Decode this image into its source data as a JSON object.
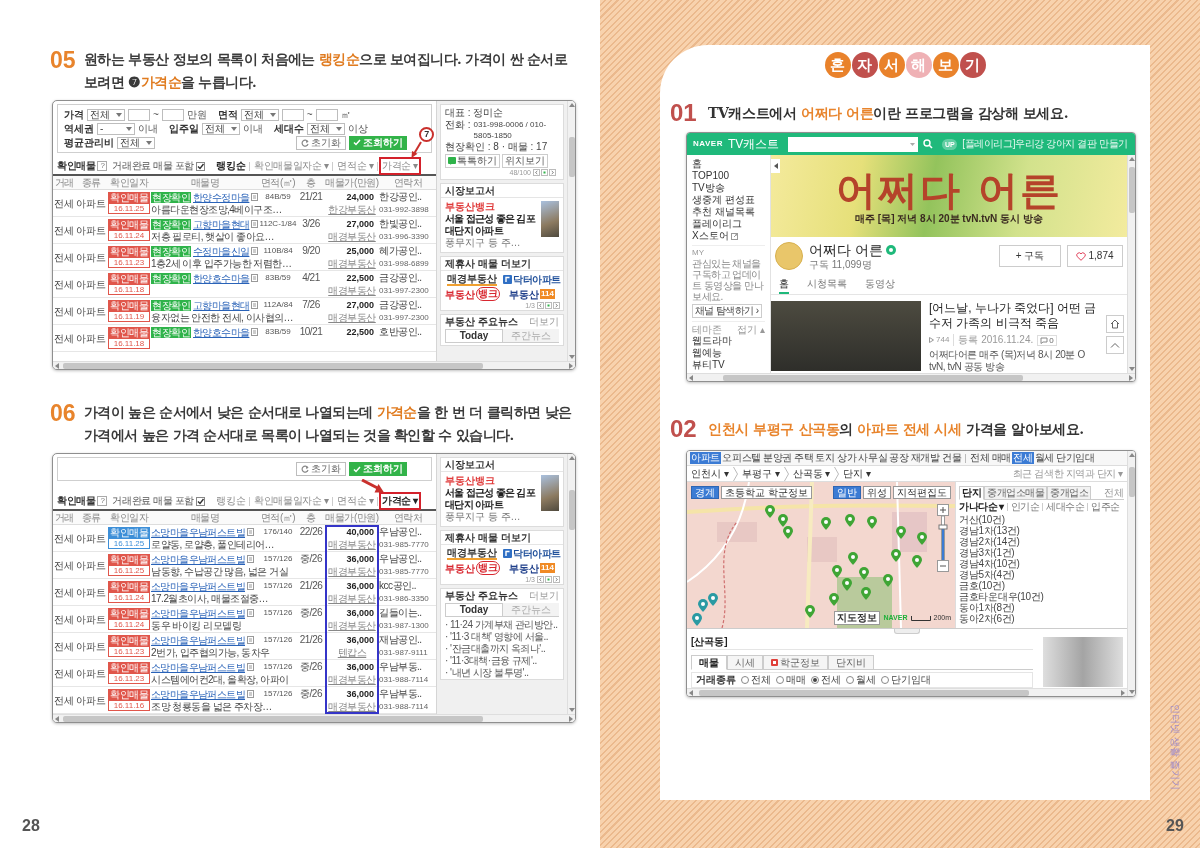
{
  "left_page": {
    "steps": [
      {
        "number": "05",
        "lines": [
          "원하는 부동산 정보의 목록이 처음에는 **랭킹순**으로 보여집니다. 가격이 싼 순서로",
          "보려면 ❼**가격순**을 누릅니다."
        ],
        "screenshot": {
          "kind": "listing",
          "filter_rows": [
            [
              {
                "kind": "label",
                "text": "가격"
              },
              {
                "kind": "select",
                "value": "전체"
              },
              {
                "kind": "input"
              },
              {
                "kind": "text",
                "text": "~"
              },
              {
                "kind": "input"
              },
              {
                "kind": "text",
                "text": "만원"
              },
              {
                "kind": "label",
                "text": "면적"
              },
              {
                "kind": "select",
                "value": "전체"
              },
              {
                "kind": "input"
              },
              {
                "kind": "text",
                "text": "~"
              },
              {
                "kind": "input"
              },
              {
                "kind": "text",
                "text": "㎡"
              }
            ],
            [
              {
                "kind": "label",
                "text": "역세권"
              },
              {
                "kind": "select",
                "value": "-"
              },
              {
                "kind": "text",
                "text": "이내"
              },
              {
                "kind": "label",
                "text": "입주일"
              },
              {
                "kind": "select",
                "value": "전체"
              },
              {
                "kind": "text",
                "text": "이내"
              },
              {
                "kind": "label",
                "text": "세대수"
              },
              {
                "kind": "select",
                "value": "전체"
              },
              {
                "kind": "text",
                "text": "이상"
              }
            ],
            [
              {
                "kind": "label",
                "text": "평균관리비"
              },
              {
                "kind": "select",
                "value": "전체"
              }
            ]
          ],
          "buttons": [
            {
              "kind": "reset",
              "label": "초기화"
            },
            {
              "kind": "search",
              "label": "조회하기"
            }
          ],
          "confirmed_label": "확인매물",
          "help": "?",
          "include_label": "거래완료 매물 포함",
          "include_checked": true,
          "sort_options": [
            {
              "label": "랭킹순",
              "selected": true
            },
            {
              "label": "확인매물일자순 ▾",
              "selected": false
            },
            {
              "label": "면적순 ▾",
              "selected": false
            },
            {
              "label": "가격순 ▾",
              "selected": false,
              "highlighted": true
            }
          ],
          "annotation": {
            "kind": "callout",
            "number": "7"
          },
          "columns": [
            "거래",
            "종류",
            "확인일자",
            "매물명",
            "면적(㎡)",
            "층",
            "매물가(만원)",
            "연락처"
          ],
          "rows": [
            {
              "deal": "전세",
              "type": "아파트",
              "badge": {
                "text": "확인매물",
                "color": "#e0564b"
              },
              "date": "16.11.25",
              "tag": "현장확인",
              "name": "한양수정마을",
              "description": "아름다운현장조망,4베이구조…",
              "area": "84B/59",
              "floor": "21/21",
              "price": "24,000",
              "agency_link": "한강부동산",
              "agency": "한강공인..",
              "phone": "031-992-3898"
            },
            {
              "deal": "전세",
              "type": "아파트",
              "badge": {
                "text": "확인매물",
                "color": "#e0564b"
              },
              "date": "16.11.24",
              "tag": "현장확인",
              "name": "고향마을현대",
              "description": "저층 필로티, 햇살이 좋아요…",
              "area": "112C-1/84",
              "floor": "3/26",
              "price": "27,000",
              "agency_link": "매경부동산",
              "agency": "한빛공인..",
              "phone": "031-996-3390"
            },
            {
              "deal": "전세",
              "type": "아파트",
              "badge": {
                "text": "확인매물",
                "color": "#e0564b"
              },
              "date": "16.11.23",
              "tag": "현장확인",
              "name": "수정마을신일",
              "description": "1층2세 이후 입주가능한 저렴한…",
              "area": "110B/84",
              "floor": "9/20",
              "price": "25,000",
              "agency_link": "매경부동산",
              "agency": "혜가공인..",
              "phone": "031-998-6899"
            },
            {
              "deal": "전세",
              "type": "아파트",
              "badge": {
                "text": "확인매물",
                "color": "#e0564b"
              },
              "date": "16.11.18",
              "tag": "현장확인",
              "name": "한양호수마을",
              "area": "83B/59",
              "floor": "4/21",
              "price": "22,500",
              "agency_link": "매경부동산",
              "agency": "금강공인..",
              "phone": "031-997-2300"
            },
            {
              "deal": "전세",
              "type": "아파트",
              "badge": {
                "text": "확인매물",
                "color": "#e0564b"
              },
              "date": "16.11.19",
              "tag": "현장확인",
              "name": "고향마을현대",
              "description": "융자없는 안전한 전세, 이사협의…",
              "area": "112A/84",
              "floor": "7/26",
              "price": "27,000",
              "agency_link": "매경부동산",
              "agency": "금강공인..",
              "phone": "031-997-2300"
            },
            {
              "deal": "전세",
              "type": "아파트",
              "badge": {
                "text": "확인매물",
                "color": "#e0564b"
              },
              "date": "16.11.18",
              "tag": "현장확인",
              "name": "한양호수마을",
              "area": "83B/59",
              "floor": "10/21",
              "price": "22,500",
              "agency": "호반공인.."
            }
          ],
          "side": {
            "agent": {
              "name_line": "대표 : 정미순",
              "phone_label": "전화 :",
              "phones": "031-998-0006 / 010-5805-1850",
              "stats": "현장확인 : 8 · 매물 : 17",
              "buttons": [
                "톡톡하기",
                "위치보기"
              ],
              "pager": "48/100"
            },
            "report": {
              "title": "시장보고서",
              "logo": "부동산뱅크",
              "headline": "서울 접근성 좋은 김포 대단지 아파트",
              "summary": "풍무지구 등 주…"
            },
            "partners": {
              "title": "제휴사 매물 더보기",
              "logos": [
                {
                  "kind": "underline",
                  "text": "매경부동산"
                },
                {
                  "kind": "tile",
                  "text": "닥터아파트"
                },
                {
                  "kind": "stamp",
                  "text": "부동산",
                  "mark": "뱅크"
                },
                {
                  "kind": "box",
                  "text": "부동산",
                  "mark": "114"
                }
              ],
              "pager": "1/3"
            },
            "news": {
              "title": "부동산 주요뉴스",
              "more": "더보기",
              "tabs": [
                {
                  "label": "Today",
                  "selected": true
                },
                {
                  "label": "주간뉴스",
                  "selected": false
                }
              ]
            }
          }
        }
      },
      {
        "number": "06",
        "lines": [
          "가격이 높은 순서에서 낮은 순서대로 나열되는데 **가격순**을 한 번 더 클릭하면 낮은",
          "가격에서 높은 가격 순서대로 목록이 나열되는 것을 확인할 수 있습니다."
        ],
        "screenshot": {
          "kind": "listing",
          "buttons": [
            {
              "kind": "reset",
              "label": "초기화"
            },
            {
              "kind": "search",
              "label": "조회하기"
            }
          ],
          "confirmed_label": "확인매물",
          "help": "?",
          "include_label": "거래완료 매물 포함",
          "include_checked": true,
          "sort_options": [
            {
              "label": "랭킹순",
              "selected": false
            },
            {
              "label": "확인매물일자순 ▾",
              "selected": false
            },
            {
              "label": "면적순 ▾",
              "selected": false
            },
            {
              "label": "가격순 ▾",
              "selected": true,
              "highlighted": true
            }
          ],
          "annotation": {
            "kind": "arrow"
          },
          "columns": [
            "거래",
            "종류",
            "확인일자",
            "매물명",
            "면적(㎡)",
            "층",
            "매물가(만원)",
            "연락처"
          ],
          "price_highlight": true,
          "rows": [
            {
              "deal": "전세",
              "type": "아파트",
              "badge": {
                "text": "확인매물",
                "color": "#3d8fd8"
              },
              "date": "16.11.25",
              "name": "소망마을우남퍼스트빌",
              "description": "로얄동, 로얄층, 풀인테리어…",
              "area": "176/140",
              "floor": "22/26",
              "price": "40,000",
              "agency_link": "매경부동산",
              "agency": "우남공인..",
              "phone": "031-985-7770"
            },
            {
              "deal": "전세",
              "type": "아파트",
              "badge": {
                "text": "확인매물",
                "color": "#e0564b"
              },
              "date": "16.11.25",
              "name": "소망마을우남퍼스트빌",
              "description": "남동향, 수납공간 많음, 넓은 거실",
              "area": "157/126",
              "floor": "중/26",
              "price": "36,000",
              "agency_link": "매경부동산",
              "agency": "우남공인..",
              "phone": "031-985-7770"
            },
            {
              "deal": "전세",
              "type": "아파트",
              "badge": {
                "text": "확인매물",
                "color": "#e0564b"
              },
              "date": "16.11.24",
              "name": "소망마을우남퍼스트빌",
              "description": "17.2월초이사, 매물조절중…",
              "area": "157/126",
              "floor": "21/26",
              "price": "36,000",
              "agency_link": "매경부동산",
              "agency": "kcc공인..",
              "phone": "031-986-3350"
            },
            {
              "deal": "전세",
              "type": "아파트",
              "badge": {
                "text": "확인매물",
                "color": "#e0564b"
              },
              "date": "16.11.24",
              "name": "소망마을우남퍼스트빌",
              "description": "동우 바이킹 리모델링",
              "area": "157/126",
              "floor": "중/26",
              "price": "36,000",
              "agency_link": "매경부동산",
              "agency": "길들이는..",
              "phone": "031-987-1300"
            },
            {
              "deal": "전세",
              "type": "아파트",
              "badge": {
                "text": "확인매물",
                "color": "#e0564b"
              },
              "date": "16.11.23",
              "name": "소망마을우남퍼스트빌",
              "description": "2번가, 입주협의가능, 동차우",
              "area": "157/126",
              "floor": "21/26",
              "price": "36,000",
              "agency_link": "텐캅스",
              "agency": "재남공인..",
              "phone": "031-987-9111"
            },
            {
              "deal": "전세",
              "type": "아파트",
              "badge": {
                "text": "확인매물",
                "color": "#e0564b"
              },
              "date": "16.11.23",
              "name": "소망마을우남퍼스트빌",
              "description": "시스템에어컨2대, 올확장, 아파이",
              "area": "157/126",
              "floor": "중/26",
              "price": "36,000",
              "agency_link": "매경부동산",
              "agency": "우남부동..",
              "phone": "031-988-7114"
            },
            {
              "deal": "전세",
              "type": "아파트",
              "badge": {
                "text": "확인매물",
                "color": "#e0564b"
              },
              "date": "16.11.16",
              "name": "소망마을우남퍼스트빌",
              "description": "조망 청룡동을 넓은 주차장…",
              "area": "157/126",
              "floor": "중/26",
              "price": "36,000",
              "agency_link": "매경부동산",
              "agency": "우남부동..",
              "phone": "031-988-7114"
            }
          ],
          "side": {
            "report": {
              "title": "시장보고서",
              "logo": "부동산뱅크",
              "headline": "서울 접근성 좋은 김포 대단지 아파트",
              "summary": "풍무지구 등 주…"
            },
            "partners": {
              "title": "제휴사 매물 더보기",
              "logos": [
                {
                  "kind": "underline",
                  "text": "매경부동산"
                },
                {
                  "kind": "tile",
                  "text": "닥터아파트"
                },
                {
                  "kind": "stamp",
                  "text": "부동산",
                  "mark": "뱅크"
                },
                {
                  "kind": "box",
                  "text": "부동산",
                  "mark": "114"
                }
              ],
              "pager": "1/3"
            },
            "news": {
              "title": "부동산 주요뉴스",
              "more": "더보기",
              "tabs": [
                {
                  "label": "Today",
                  "selected": true
                },
                {
                  "label": "주간뉴스",
                  "selected": false
                }
              ],
              "items": [
                "· 11·24 가계부채 관리방안..",
                "· '11·3 대책' 영향에 서울..",
                "· '잔금대출까지 옥죄나'..",
                "· '11·3대책·금융 규제'..",
                "· '내년 시장 불투명'.."
              ]
            }
          }
        }
      }
    ],
    "page_number": "28"
  },
  "right_page": {
    "title_badges": [
      {
        "text": "혼",
        "color": "#e9822b"
      },
      {
        "text": "자",
        "color": "#c0504d"
      },
      {
        "text": "서",
        "color": "#e9822b"
      },
      {
        "text": "해",
        "color": "#efb1b5"
      },
      {
        "text": "보",
        "color": "#e9822b"
      },
      {
        "text": "기",
        "color": "#c0504d"
      }
    ],
    "steps": [
      {
        "number": "01",
        "lines": [
          "TV캐스트에서 **어쩌다 어른**이란 프로그램을 감상해 보세요."
        ],
        "screenshot": {
          "kind": "tvcast",
          "brand": "NAVER",
          "service": "TV캐스트",
          "notice_badge": "UP",
          "notice": "[플레이리그]우리강 강아지 결판 만들기",
          "menu": [
            {
              "label": "홈"
            },
            {
              "label": "TOP100"
            },
            {
              "label": "TV방송"
            },
            {
              "label": "생중계 편성표"
            },
            {
              "label": "추천 채널목록"
            },
            {
              "label": "플레이리그"
            },
            {
              "label": "X스토어",
              "external": true
            }
          ],
          "my": {
            "title": "MY",
            "text": "관심있는 채널을 구독하고 업데이트 동영상을 만나보세요.",
            "button": "채널 탐색하기 ›"
          },
          "theme": {
            "title": "테마존",
            "toggle": "접기 ▴",
            "items": [
              "웹드라마",
              "웹예능",
              "뷰티TV"
            ]
          },
          "banner": {
            "title": "어쩌다 어른",
            "subtitle": "매주 [목] 저녁 8시 20분 tvN.tvN 동시 방송"
          },
          "channel": {
            "name": "어쩌다 어른",
            "verified": true,
            "subscribers": "구독 11,099명",
            "subscribe": "+ 구독",
            "likes": "1,874"
          },
          "tabs": [
            {
              "label": "홈",
              "selected": true
            },
            {
              "label": "시청목록",
              "selected": false
            },
            {
              "label": "동영상",
              "selected": false
            }
          ],
          "video": {
            "title": "[어느날, 누나가 죽었다] 어떤 금수저 가족의 비극적 죽음",
            "views": "744",
            "date": "등록 2016.11.24.",
            "comments": "0",
            "description": "어쩌다어른 매주 (목)저녁 8시 20분 O tvN, tvN 공동 방송"
          }
        }
      },
      {
        "number": "02",
        "lines": [
          "**인천시 부평구 산곡동**의 **아파트 전세 시세** 가격을 알아보세요."
        ],
        "screenshot": {
          "kind": "map",
          "property_tabs": [
            {
              "label": "아파트",
              "selected": true
            },
            {
              "label": "오피스텔",
              "selected": false
            },
            {
              "label": "분양권",
              "selected": false
            },
            {
              "label": "주택",
              "selected": false
            },
            {
              "label": "토지",
              "selected": false
            },
            {
              "label": "상가",
              "selected": false
            },
            {
              "label": "사무실",
              "selected": false
            },
            {
              "label": "공장",
              "selected": false
            },
            {
              "label": "재개발",
              "selected": false
            },
            {
              "label": "건물",
              "selected": false
            }
          ],
          "deal_tabs": [
            {
              "label": "전체",
              "selected": false
            },
            {
              "label": "매매",
              "selected": false
            },
            {
              "label": "전세",
              "selected": true
            },
            {
              "label": "월세",
              "selected": false
            },
            {
              "label": "단기임대",
              "selected": false
            }
          ],
          "breadcrumb": [
            "인천시 ▾",
            "부평구 ▾",
            "산곡동 ▾",
            "단지 ▾"
          ],
          "recent": "최근 검색한 지역과 단지 ▾",
          "overlay_buttons": [
            {
              "label": "경계",
              "selected": true
            },
            {
              "label": "초등학교 학군정보",
              "selected": false
            }
          ],
          "map_types": [
            {
              "label": "일반",
              "selected": true
            },
            {
              "label": "위성",
              "selected": false
            },
            {
              "label": "지적편집도",
              "selected": false
            }
          ],
          "map_footer": {
            "info": "지도정보",
            "brand": "NAVER",
            "scale": "200m"
          },
          "list_tabs": [
            {
              "label": "단지",
              "selected": true
            },
            {
              "label": "중개업소매물",
              "selected": false
            },
            {
              "label": "중개업소",
              "selected": false
            }
          ],
          "list_more": "전체",
          "sort_options": [
            {
              "label": "가나다순 ▾",
              "selected": true
            },
            {
              "label": "인기순",
              "selected": false
            },
            {
              "label": "세대수순",
              "selected": false
            },
            {
              "label": "입주순",
              "selected": false
            }
          ],
          "complexes": [
            "거산(10건)",
            "경남1차(13건)",
            "경남2차(14건)",
            "경남3차(1건)",
            "경남4차(10건)",
            "경남5차(4건)",
            "금호(10건)",
            "금호타운대우(10건)",
            "동아1차(8건)",
            "동아2차(6건)"
          ],
          "area_title": "[산곡동]",
          "detail_tabs": [
            {
              "label": "매물",
              "selected": true
            },
            {
              "label": "시세",
              "selected": false
            },
            {
              "label": "학군정보",
              "selected": false,
              "has_icon": true
            },
            {
              "label": "단지비",
              "selected": false
            }
          ],
          "deal_filter": {
            "label": "거래종류",
            "options": [
              {
                "label": "전체",
                "selected": false
              },
              {
                "label": "매매",
                "selected": false
              },
              {
                "label": "전세",
                "selected": true
              },
              {
                "label": "월세",
                "selected": false
              },
              {
                "label": "단기임대",
                "selected": false
              }
            ]
          }
        }
      }
    ],
    "side_label": "인터넷 생활 즐기기",
    "page_number": "29"
  }
}
